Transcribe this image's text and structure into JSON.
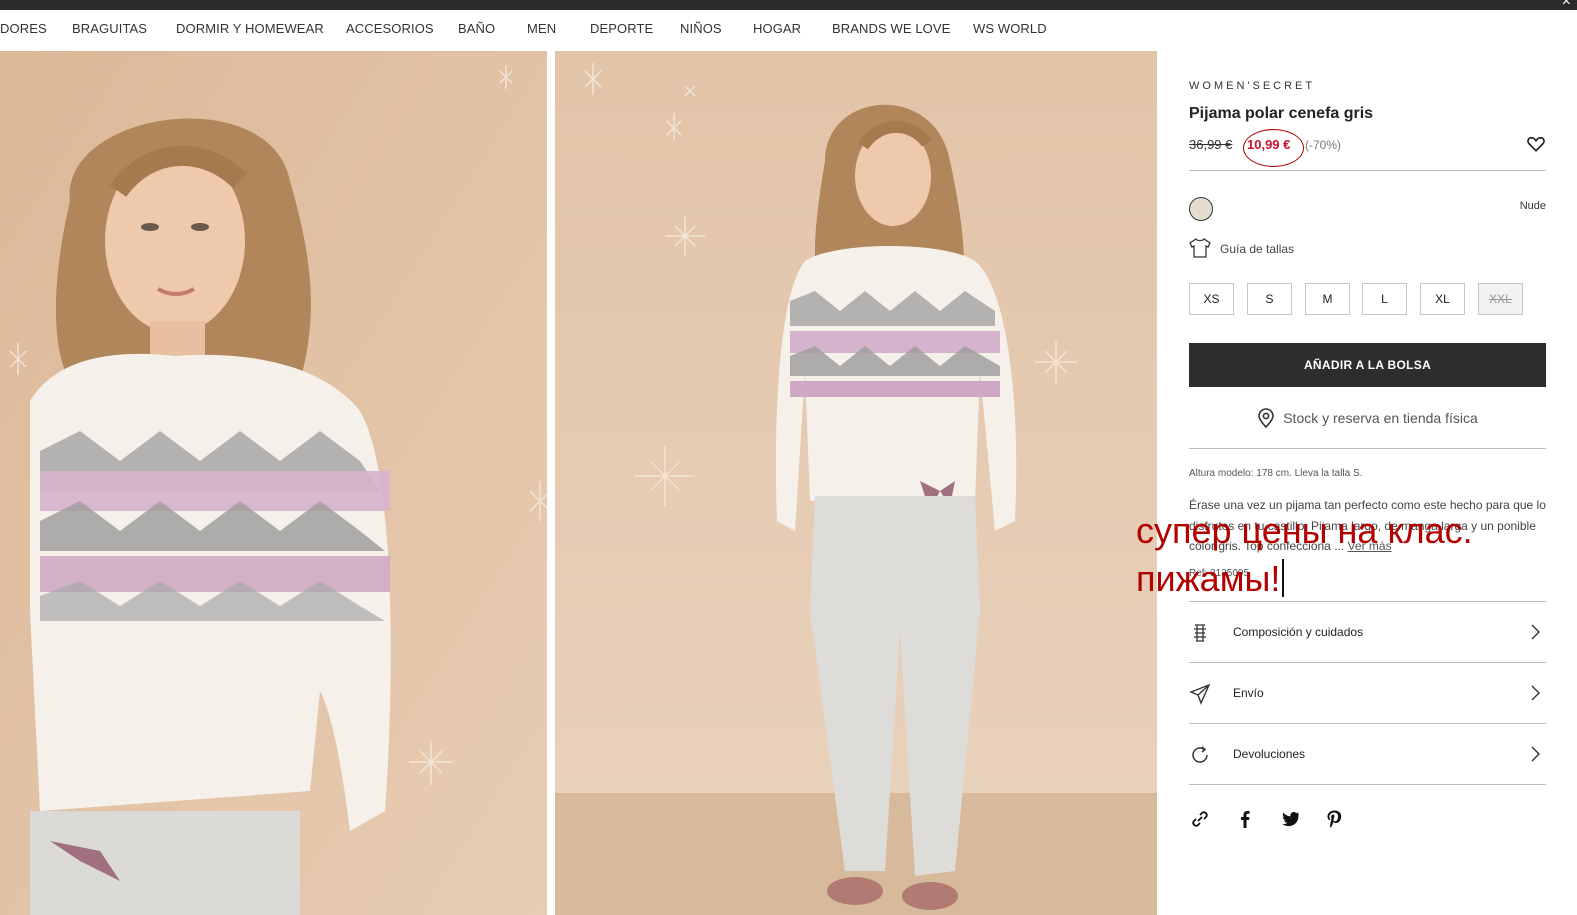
{
  "nav": {
    "items": [
      "DORES",
      "BRAGUITAS",
      "DORMIR Y HOMEWEAR",
      "ACCESORIOS",
      "BAÑO",
      "MEN",
      "DEPORTE",
      "NIÑOS",
      "HOGAR",
      "BRANDS WE LOVE",
      "WS WORLD"
    ]
  },
  "topbar": {
    "close": "×"
  },
  "product": {
    "brand": "WOMEN'SECRET",
    "title": "Pijama polar cenefa gris",
    "old_price": "36,99 €",
    "new_price": "10,99 €",
    "discount": "(-70%)",
    "color_name": "Nude",
    "size_guide": "Guía de tallas",
    "sizes": [
      {
        "label": "XS",
        "available": true
      },
      {
        "label": "S",
        "available": true
      },
      {
        "label": "M",
        "available": true
      },
      {
        "label": "L",
        "available": true
      },
      {
        "label": "XL",
        "available": true
      },
      {
        "label": "XXL",
        "available": false
      }
    ],
    "add_to_bag": "AÑADIR A LA BOLSA",
    "stock": "Stock y reserva en tienda física",
    "model_info": "Altura modelo: 178 cm.   Lleva la talla S.",
    "description": "Érase una vez un pijama tan perfecto como este hecho para que lo disfrutes en tu castillo. Pijama largo, de manga larga y un ponible color gris. Top confecciona ...",
    "ver_mas": "Ver más",
    "ref": "Ref: 3135095",
    "accordion": [
      "Composición y cuidados",
      "Envío",
      "Devoluciones"
    ]
  },
  "overlay_text": {
    "line1": "супер цены на клас.",
    "line2": "пижамы!"
  },
  "colors": {
    "sale": "#c8102e",
    "button": "#2d2d2d",
    "annotation": "#b30000",
    "photo_bg": "#e3c6aa"
  }
}
